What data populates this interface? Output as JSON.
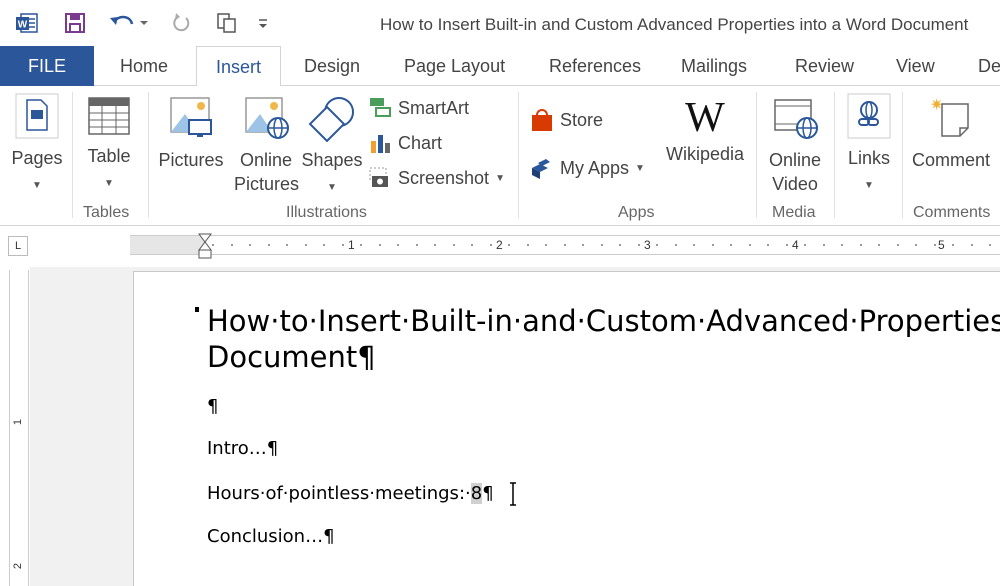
{
  "window": {
    "title": "How to Insert Built-in and Custom Advanced Properties into a Word Document",
    "app_icon_letter": "W"
  },
  "quick_access": {
    "icons": [
      "word-icon",
      "save-icon",
      "undo-icon",
      "redo-icon",
      "copy-icon",
      "customize-icon"
    ]
  },
  "tabs": [
    "FILE",
    "Home",
    "Insert",
    "Design",
    "Page Layout",
    "References",
    "Mailings",
    "Review",
    "View",
    "De"
  ],
  "ribbon": {
    "pages": "Pages",
    "table": "Table",
    "pictures": "Pictures",
    "online_pictures_1": "Online",
    "online_pictures_2": "Pictures",
    "shapes": "Shapes",
    "smartart": "SmartArt",
    "chart": "Chart",
    "screenshot": "Screenshot",
    "store": "Store",
    "my_apps": "My Apps",
    "wikipedia": "Wikipedia",
    "wiki_logo": "W",
    "online_video_1": "Online",
    "online_video_2": "Video",
    "links": "Links",
    "comment": "Comment",
    "groups": [
      "Tables",
      "Illustrations",
      "Apps",
      "Media",
      "Comments"
    ]
  },
  "ruler": {
    "corner_symbol": "L",
    "numbers": [
      "1",
      "2",
      "3",
      "4",
      "5"
    ],
    "vertical_numbers": [
      "1",
      "2"
    ]
  },
  "document": {
    "heading_line1": "How·to·Insert·Built-in·and·Custom·Advanced·Properties·into·a·Word·",
    "heading_line2": "Document¶",
    "para_empty": "¶",
    "para_intro": "Intro…¶",
    "para_hours_prefix": "Hours·of·pointless·meetings:·",
    "para_hours_field": "8",
    "para_hours_suffix": "¶",
    "para_conclusion": "Conclusion…¶"
  },
  "colors": {
    "accent": "#2b579a",
    "word_blue": "#2b579a",
    "store_red": "#d83b01"
  }
}
